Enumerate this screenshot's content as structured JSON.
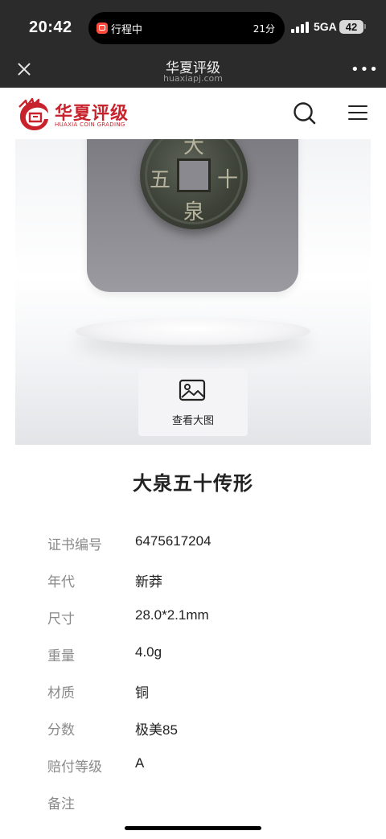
{
  "status_bar": {
    "time": "20:42",
    "activity_label": "行程中",
    "activity_timer": "21分",
    "network": "5GA",
    "battery": "42"
  },
  "browser": {
    "title": "华夏评级",
    "url": "huaxiapj.com"
  },
  "site_header": {
    "logo_text": "华夏评级",
    "logo_subtitle": "HUAXIA COIN GRADING",
    "brand_color": "#c8232c"
  },
  "image_area": {
    "view_large_label": "查看大图"
  },
  "product": {
    "title": "大泉五十传形",
    "coin_characters": [
      "大",
      "泉",
      "五",
      "十"
    ]
  },
  "details": [
    {
      "label": "证书编号",
      "value": "6475617204"
    },
    {
      "label": "年代",
      "value": "新莽"
    },
    {
      "label": "尺寸",
      "value": "28.0*2.1mm"
    },
    {
      "label": "重量",
      "value": "4.0g"
    },
    {
      "label": "材质",
      "value": "铜"
    },
    {
      "label": "分数",
      "value": "极美85"
    },
    {
      "label": "赔付等级",
      "value": "A"
    },
    {
      "label": "备注",
      "value": ""
    }
  ]
}
